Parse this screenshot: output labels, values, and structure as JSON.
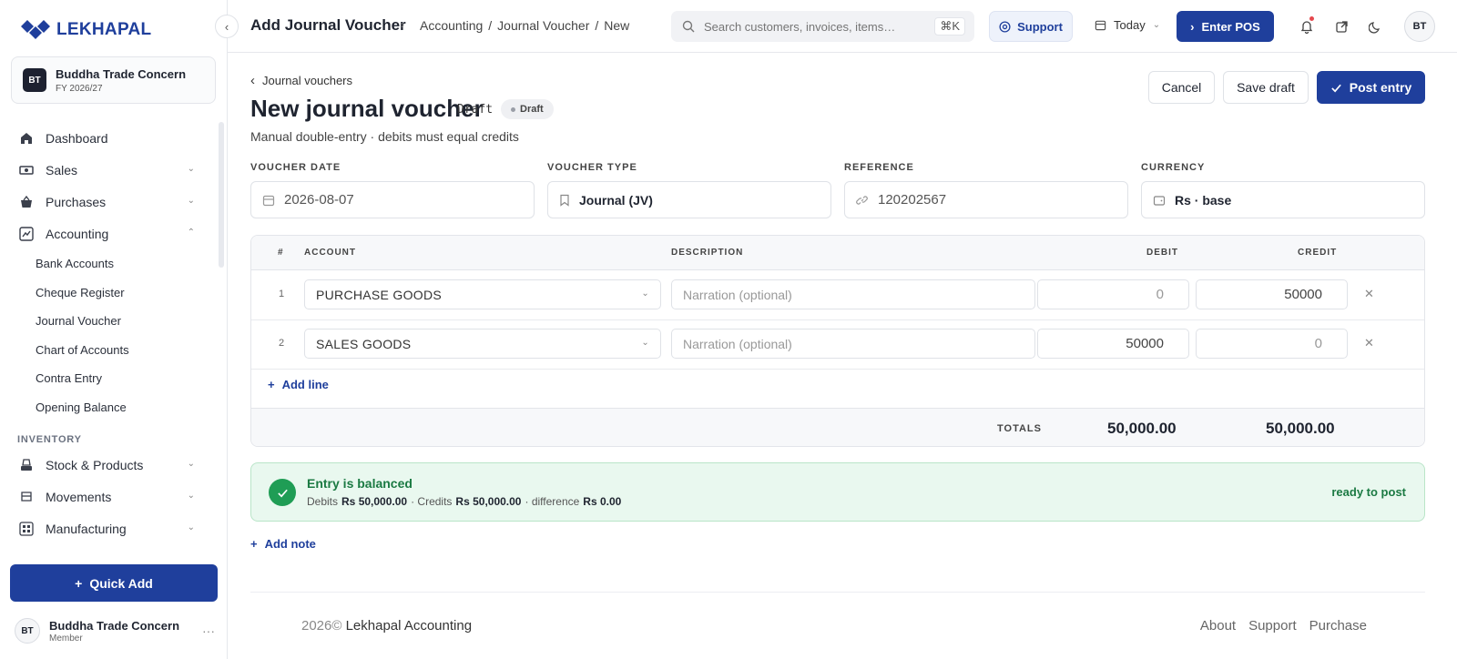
{
  "app": {
    "brand": "LEKHAPAL",
    "org": {
      "initials": "BT",
      "name": "Buddha Trade Concern",
      "fiscal_year": "FY 2026/27"
    }
  },
  "sidebar": {
    "items": [
      {
        "label": "Dashboard",
        "icon": "home-icon"
      },
      {
        "label": "Sales",
        "icon": "sales-icon",
        "expandable": true
      },
      {
        "label": "Purchases",
        "icon": "basket-icon",
        "expandable": true
      },
      {
        "label": "Accounting",
        "icon": "chart-icon",
        "expanded": true
      }
    ],
    "accounting_subitems": [
      "Bank Accounts",
      "Cheque Register",
      "Journal Voucher",
      "Chart of Accounts",
      "Contra Entry",
      "Opening Balance"
    ],
    "section_inventory": "INVENTORY",
    "inventory_items": [
      {
        "label": "Stock & Products",
        "icon": "box-icon"
      },
      {
        "label": "Movements",
        "icon": "truck-icon"
      },
      {
        "label": "Manufacturing",
        "icon": "factory-icon"
      }
    ],
    "quick_add": "Quick Add",
    "user": {
      "initials": "BT",
      "name": "Buddha Trade Concern",
      "role": "Member"
    }
  },
  "topbar": {
    "title": "Add Journal Voucher",
    "breadcrumb": [
      "Accounting",
      "/",
      "Journal Voucher",
      "/",
      "New"
    ],
    "search_placeholder": "Search customers, invoices, items…",
    "search_shortcut": "⌘K",
    "support": "Support",
    "date_filter": "Today",
    "enter_pos": "Enter POS",
    "avatar": "BT"
  },
  "page": {
    "back": "Journal vouchers",
    "title": "New journal voucher",
    "status_code": "Draft",
    "status_badge": "Draft",
    "subtitle": "Manual double-entry · debits must equal credits",
    "actions": {
      "cancel": "Cancel",
      "save": "Save draft",
      "post": "Post entry"
    }
  },
  "form": {
    "voucher_date": {
      "label": "VOUCHER DATE",
      "value": "2026-08-07"
    },
    "voucher_type": {
      "label": "VOUCHER TYPE",
      "value": "Journal (JV)"
    },
    "reference": {
      "label": "REFERENCE",
      "value": "120202567"
    },
    "currency": {
      "label": "CURRENCY",
      "value": "Rs · base"
    }
  },
  "lines": {
    "headers": {
      "num": "#",
      "account": "ACCOUNT",
      "description": "DESCRIPTION",
      "debit": "DEBIT",
      "credit": "CREDIT"
    },
    "rows": [
      {
        "num": "1",
        "account": "PURCHASE GOODS",
        "description_placeholder": "Narration (optional)",
        "debit": "0",
        "credit": "50000"
      },
      {
        "num": "2",
        "account": "SALES GOODS",
        "description_placeholder": "Narration (optional)",
        "debit": "50000",
        "credit": "0"
      }
    ],
    "add_line": "Add line",
    "totals_label": "TOTALS",
    "total_debit": "50,000.00",
    "total_credit": "50,000.00"
  },
  "balance": {
    "title": "Entry is balanced",
    "debits_label": "Debits",
    "debits_value": "Rs 50,000.00",
    "credits_label": "· Credits",
    "credits_value": "Rs 50,000.00",
    "difference_label": "· difference",
    "difference_value": "Rs 0.00",
    "status": "ready to post"
  },
  "add_note": "Add note",
  "footer": {
    "year": "2026©",
    "company": "Lekhapal Accounting",
    "links": [
      "About",
      "Support",
      "Purchase"
    ]
  },
  "colors": {
    "primary": "#1f3f9c",
    "success": "#1f9d55",
    "success_bg": "#e9f8ef"
  }
}
